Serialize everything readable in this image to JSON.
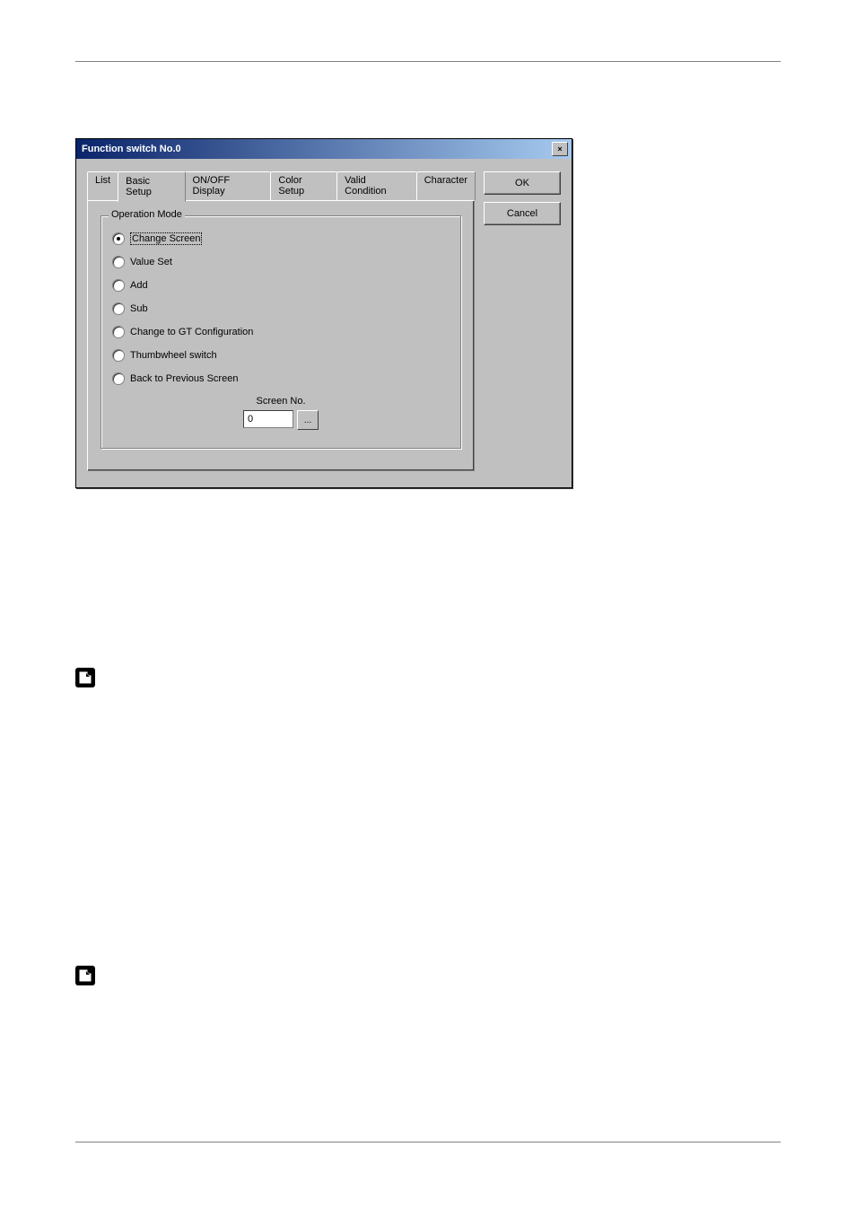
{
  "dialog": {
    "title": "Function switch No.0",
    "tabs": {
      "list": "List",
      "basic": "Basic Setup",
      "onoff": "ON/OFF Display",
      "color": "Color Setup",
      "valid": "Valid Condition",
      "char": "Character"
    },
    "group_title": "Operation Mode",
    "radios": {
      "change_screen": "Change Screen",
      "value_set": "Value Set",
      "add": "Add",
      "sub": "Sub",
      "gt_config": "Change to GT Configuration",
      "thumbwheel": "Thumbwheel switch",
      "back_prev": "Back to Previous Screen"
    },
    "screen_no_label": "Screen No.",
    "screen_no_value": "0",
    "browse_label": "...",
    "buttons": {
      "ok": "OK",
      "cancel": "Cancel"
    }
  }
}
